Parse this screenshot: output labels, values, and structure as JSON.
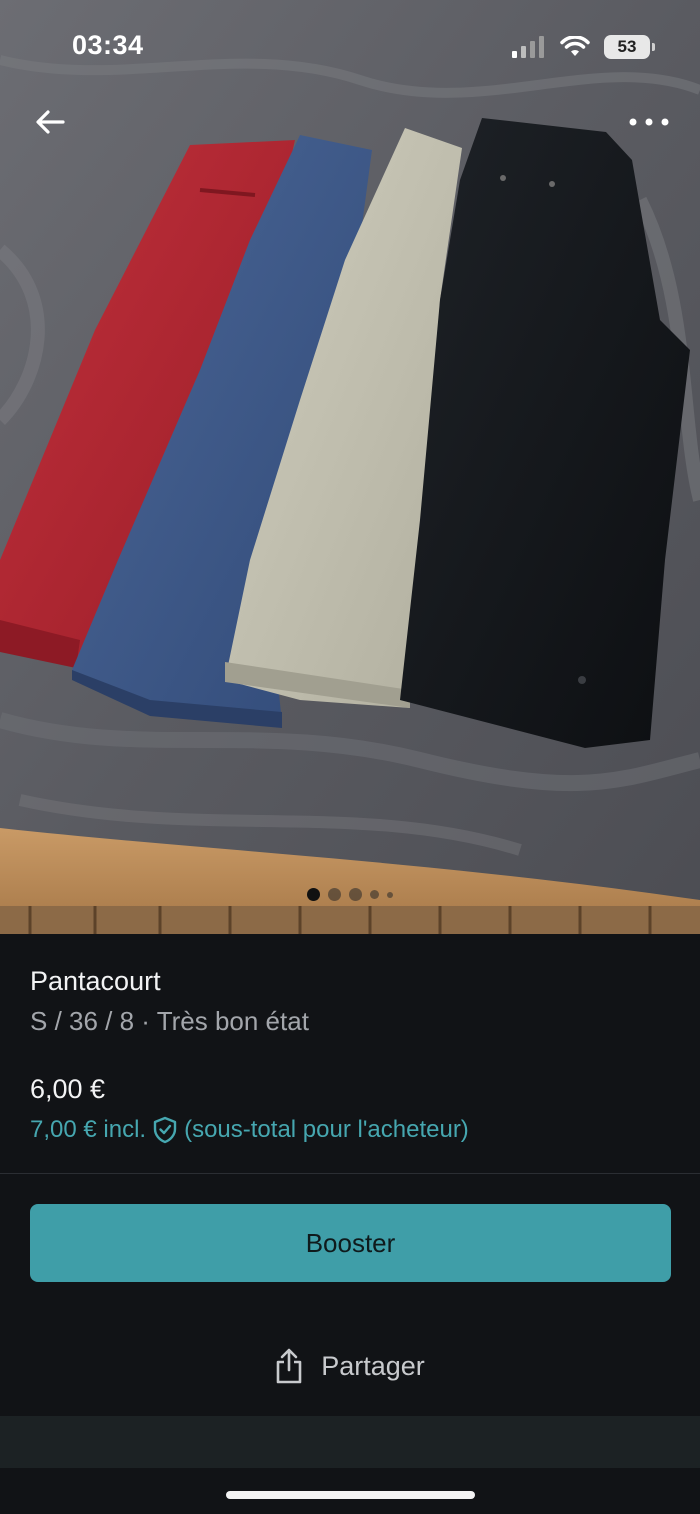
{
  "status_bar": {
    "time": "03:34",
    "battery": "53"
  },
  "photo": {
    "description_icon_back": "arrow-left-icon",
    "description_icon_more": "more-horizontal-icon",
    "carousel": {
      "count": 5,
      "active_index": 0
    }
  },
  "item": {
    "title": "Pantacourt",
    "subtitle": "S / 36 / 8 · Très bon état",
    "price": "6,00 €",
    "buyer_price": "7,00 € incl.",
    "buyer_note": "(sous-total pour l'acheteur)"
  },
  "actions": {
    "booster_label": "Booster",
    "share_label": "Partager"
  },
  "colors": {
    "accent": "#3f9ea8",
    "accent_text": "#46a7b0",
    "background": "#111316"
  }
}
